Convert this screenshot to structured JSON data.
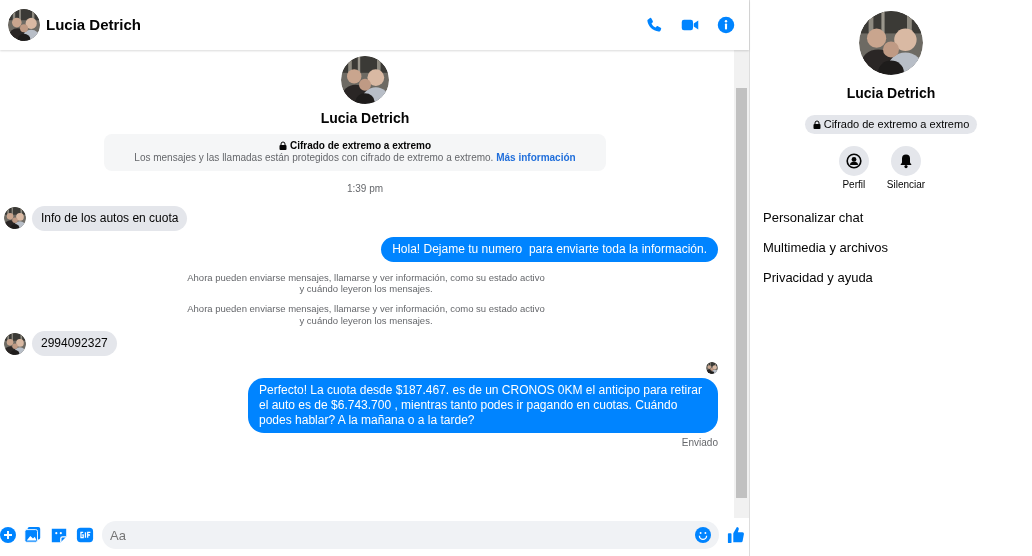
{
  "header": {
    "name": "Lucia Detrich"
  },
  "intro": {
    "name": "Lucia Detrich",
    "encryption_title": "Cifrado de extremo a extremo",
    "encryption_text": "Los mensajes y las llamadas están protegidos con cifrado de extremo a extremo.",
    "encryption_link": "Más información"
  },
  "messages": [
    {
      "kind": "time",
      "text": "1:39 pm"
    },
    {
      "kind": "incoming",
      "text": "Info de los autos en cuota"
    },
    {
      "kind": "outgoing",
      "text": "Hola! Dejame tu numero  para enviarte toda la información."
    },
    {
      "kind": "notice",
      "text": "Ahora pueden enviarse mensajes, llamarse y ver información, como su estado activo y cuándo leyeron los mensajes."
    },
    {
      "kind": "notice",
      "text": "Ahora pueden enviarse mensajes, llamarse y ver información, como su estado activo y cuándo leyeron los mensajes."
    },
    {
      "kind": "incoming",
      "text": "2994092327"
    },
    {
      "kind": "receipt"
    },
    {
      "kind": "outgoing",
      "text": "Perfecto! La cuota desde $187.467. es de un CRONOS 0KM el anticipo para retirar el auto es de $6.743.700 , mientras tanto podes ir pagando en cuotas. Cuándo podes hablar? A la mañana o a la tarde?"
    },
    {
      "kind": "status",
      "text": "Enviado"
    }
  ],
  "composer": {
    "placeholder": "Aa"
  },
  "info_panel": {
    "name": "Lucia Detrich",
    "encryption_badge": "Cifrado de extremo a extremo",
    "actions": [
      {
        "kind": "profile",
        "label": "Perfil"
      },
      {
        "kind": "mute",
        "label": "Silenciar"
      }
    ],
    "sections": [
      {
        "label": "Personalizar chat"
      },
      {
        "label": "Multimedia y archivos"
      },
      {
        "label": "Privacidad y ayuda"
      }
    ]
  }
}
